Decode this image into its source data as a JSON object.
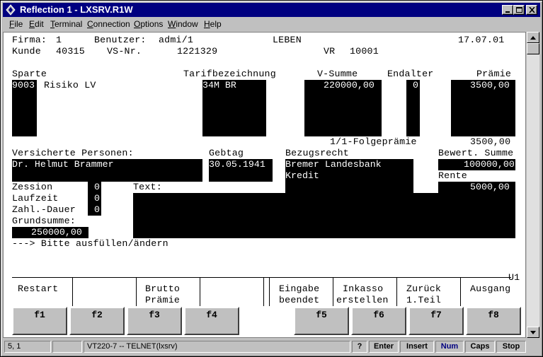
{
  "window": {
    "title": "Reflection 1 - LXSRV.R1W"
  },
  "menu": [
    {
      "label": "File",
      "u": "F",
      "rest": "ile"
    },
    {
      "label": "Edit",
      "u": "E",
      "rest": "dit"
    },
    {
      "label": "Terminal",
      "u": "T",
      "rest": "erminal"
    },
    {
      "label": "Connection",
      "u": "C",
      "rest": "onnection"
    },
    {
      "label": "Options",
      "u": "O",
      "rest": "ptions"
    },
    {
      "label": "Window",
      "u": "W",
      "rest": "indow"
    },
    {
      "label": "Help",
      "u": "H",
      "rest": "elp"
    }
  ],
  "header": {
    "firma_label": "Firma:",
    "firma_value": "1",
    "benutzer_label": "Benutzer:",
    "benutzer_value": "admi/1",
    "sparte_title": "LEBEN",
    "date": "17.07.01",
    "kunde_label": "Kunde",
    "kunde_value": "40315",
    "vsnr_label": "VS-Nr.",
    "vsnr_value": "1221329",
    "vr_label": "VR",
    "vr_value": "10001"
  },
  "table": {
    "col_sparte": "Sparte",
    "col_tarif": "Tarifbezeichnung",
    "col_vsumme": "V-Summe",
    "col_endalter": "Endalter",
    "col_praemie": "Prämie",
    "row_sparte_code": "9003",
    "row_sparte_name": "Risiko LV",
    "row_tarif": "34M BR",
    "row_vsumme": "220000,00",
    "row_endalter": "0",
    "row_praemie": "3500,00",
    "folge_label": "1/1-Folgeprämie",
    "folge_value": "3500,00"
  },
  "persons": {
    "vp_label": "Versicherte Personen:",
    "vp_value": "Dr. Helmut Brammer",
    "gebtag_label": "Gebtag",
    "gebtag_value": "30.05.1941",
    "bezug_label": "Bezugsrecht",
    "bezug_line1": "Bremer Landesbank",
    "bezug_line2": "Kredit",
    "bewert_label": "Bewert. Summe",
    "bewert_value": "100000,00",
    "rente_label": "Rente",
    "rente_value": "5000,00"
  },
  "misc": {
    "zession_label": "Zession",
    "zession_value": "0",
    "laufzeit_label": "Laufzeit",
    "laufzeit_value": "0",
    "zahldauer_label": "Zahl.-Dauer",
    "zahldauer_value": "0",
    "text_label": "Text:",
    "grundsumme_label": "Grundsumme:",
    "grundsumme_value": "250000,00",
    "message": "---> Bitte ausfüllen/ändern"
  },
  "softkeys": {
    "screen_id": "U1",
    "labels": [
      {
        "l1": "Restart",
        "l2": ""
      },
      {
        "l1": "",
        "l2": ""
      },
      {
        "l1": "Brutto",
        "l2": "Prämie"
      },
      {
        "l1": "",
        "l2": ""
      },
      {
        "l1": "Eingabe",
        "l2": "beendet"
      },
      {
        "l1": "Inkasso",
        "l2": "erstellen"
      },
      {
        "l1": "Zurück",
        "l2": "1.Teil"
      },
      {
        "l1": "Ausgang",
        "l2": ""
      }
    ],
    "keys": [
      "f1",
      "f2",
      "f3",
      "f4",
      "f5",
      "f6",
      "f7",
      "f8"
    ]
  },
  "statusbar": {
    "cursor": "5, 1",
    "connection": "VT220-7 -- TELNET(lxsrv)",
    "help": "?",
    "enter": "Enter",
    "insert": "Insert",
    "num": "Num",
    "caps": "Caps",
    "stop": "Stop",
    "num_color": "#000080"
  },
  "colors": {
    "titlebar": "#000080",
    "field_bg": "#000000",
    "field_fg": "#ffffff"
  }
}
